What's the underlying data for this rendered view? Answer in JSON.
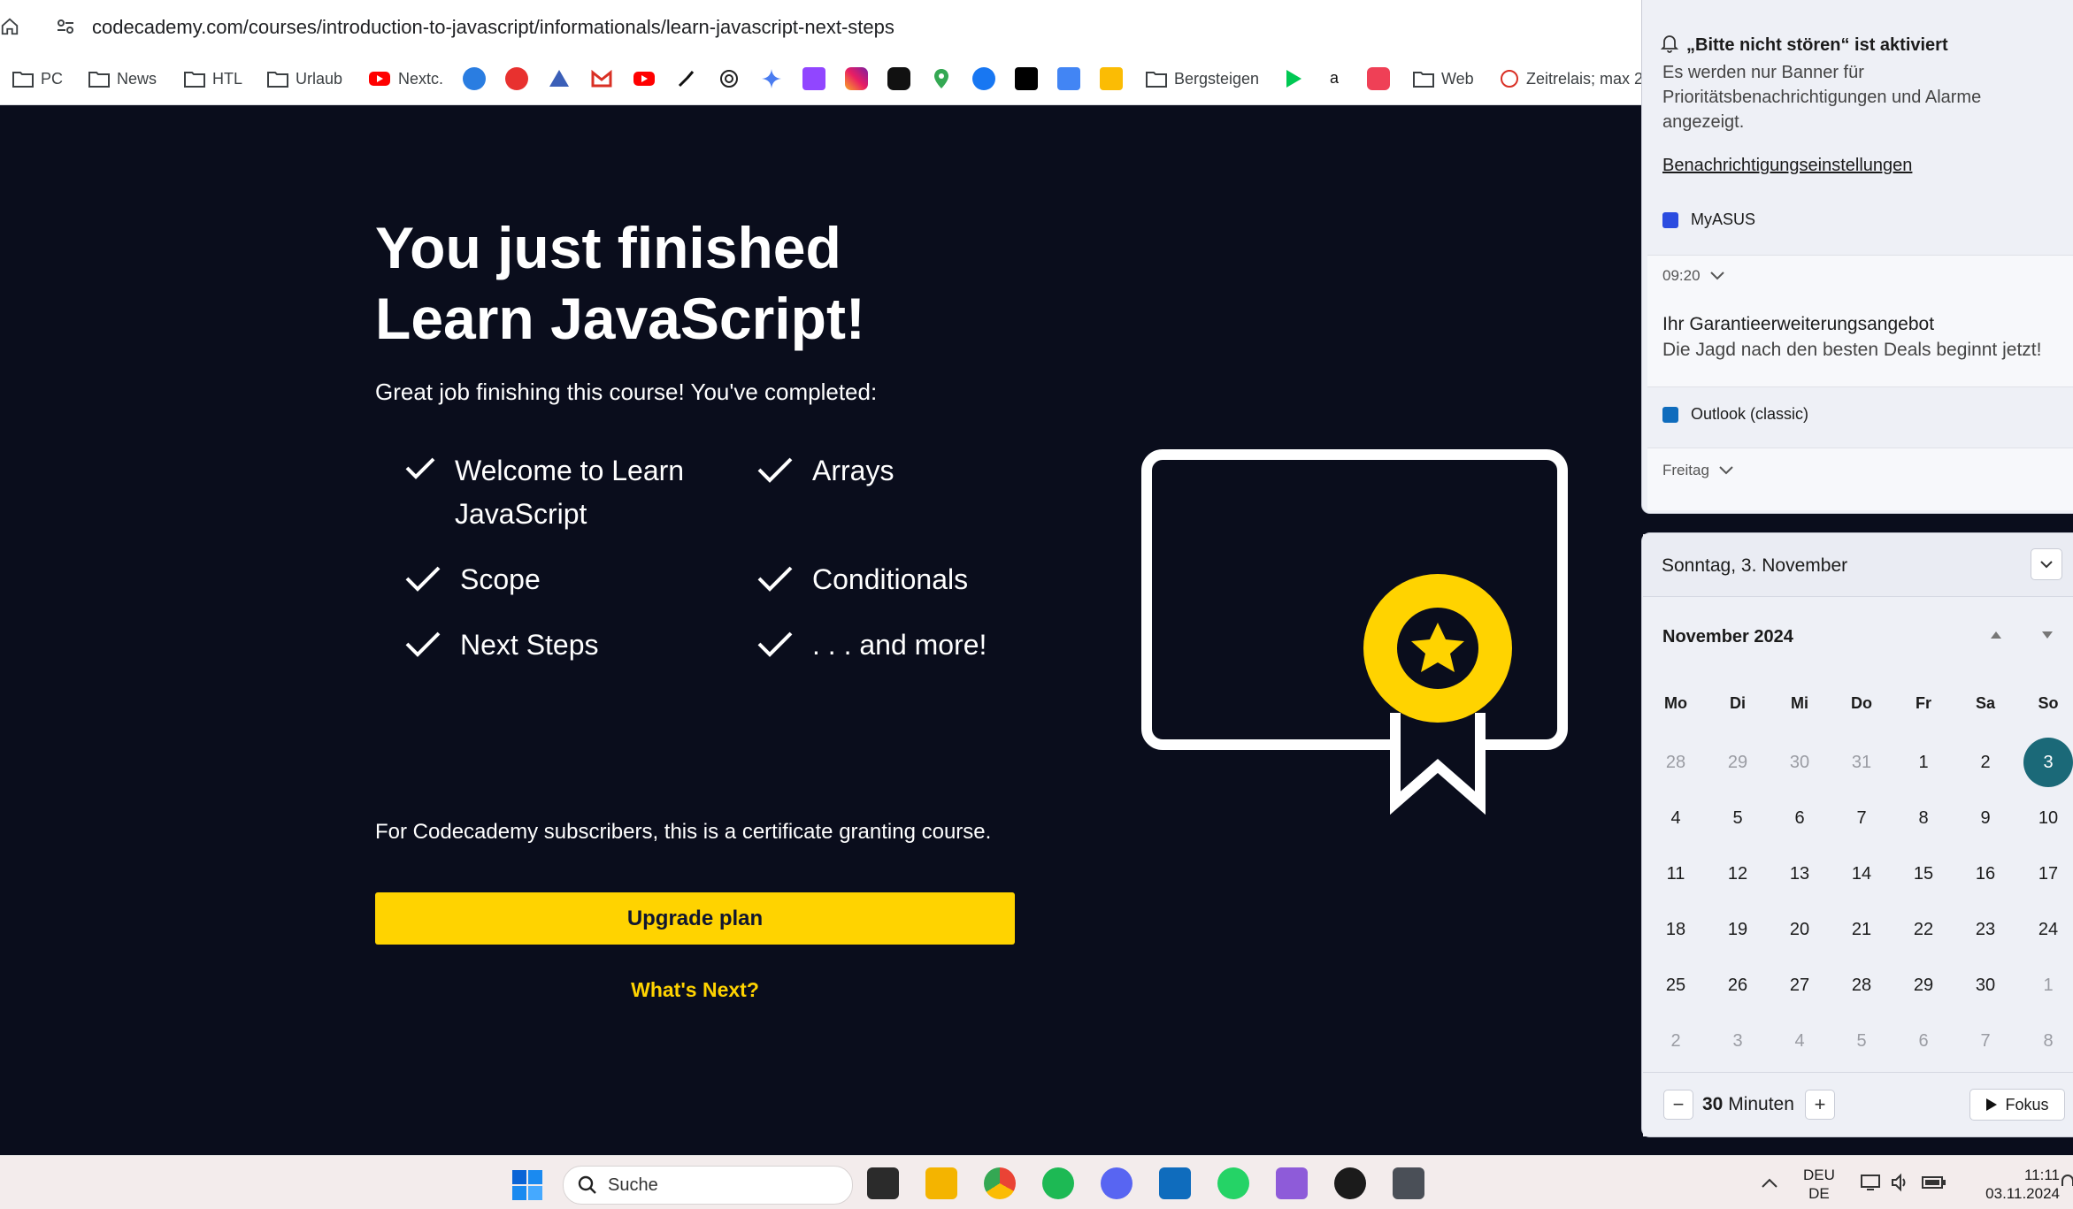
{
  "browser": {
    "url": "codecademy.com/courses/introduction-to-javascript/informationals/learn-javascript-next-steps",
    "bookmarks": [
      {
        "label": "PC",
        "icon": "folder-icon"
      },
      {
        "label": "News",
        "icon": "folder-icon"
      },
      {
        "label": "HTL",
        "icon": "folder-icon"
      },
      {
        "label": "Urlaub",
        "icon": "folder-icon"
      },
      {
        "label": "Nextc.",
        "icon": "youtube-icon"
      },
      {
        "label": "Bergsteigen",
        "icon": "folder-icon"
      },
      {
        "label": "Web",
        "icon": "folder-icon"
      },
      {
        "label": "Zeitrelais; max 2",
        "icon": "site-icon"
      }
    ]
  },
  "course": {
    "title_line1": "You just finished",
    "title_line2": "Learn JavaScript!",
    "completed_intro": "Great job finishing this course! You've completed:",
    "topics": [
      "Welcome to Learn",
      "JavaScript",
      "Arrays",
      "Scope",
      "Conditionals",
      "Next Steps",
      ". . . and more!"
    ],
    "certificate_note": "For Codecademy subscribers, this is a certificate granting course.",
    "upgrade_label": "Upgrade plan",
    "whats_next_label": "What's Next?",
    "accent_color": "#ffd300",
    "background_color": "#0a0d1c"
  },
  "notifications": {
    "dnd_title": "„Bitte nicht stören“ ist aktiviert",
    "dnd_description": "Es werden nur Banner für Prioritätsbenachrichtigungen und Alarme angezeigt.",
    "settings_link": "Benachrichtigungseinstellungen",
    "groups": [
      {
        "app": "MyASUS",
        "time": "09:20",
        "title": "Ihr Garantieerweiterungsangebot",
        "body": "Die Jagd nach den besten Deals beginnt jetzt!"
      },
      {
        "app": "Outlook (classic)",
        "time": "Freitag"
      }
    ]
  },
  "calendar": {
    "date_header": "Sonntag, 3. November",
    "month_label": "November 2024",
    "weekdays": [
      "Mo",
      "Di",
      "Mi",
      "Do",
      "Fr",
      "Sa",
      "So"
    ],
    "weeks": [
      [
        "28",
        "29",
        "30",
        "31",
        "1",
        "2",
        "3"
      ],
      [
        "4",
        "5",
        "6",
        "7",
        "8",
        "9",
        "10"
      ],
      [
        "11",
        "12",
        "13",
        "14",
        "15",
        "16",
        "17"
      ],
      [
        "18",
        "19",
        "20",
        "21",
        "22",
        "23",
        "24"
      ],
      [
        "25",
        "26",
        "27",
        "28",
        "29",
        "30",
        "1"
      ],
      [
        "2",
        "3",
        "4",
        "5",
        "6",
        "7",
        "8"
      ]
    ],
    "today": "3",
    "focus_minutes": "30",
    "focus_unit": "Minuten",
    "focus_button": "Fokus"
  },
  "taskbar": {
    "search_placeholder": "Suche",
    "lang_line1": "DEU",
    "lang_line2": "DE",
    "time": "11:11",
    "date": "03.11.2024"
  }
}
